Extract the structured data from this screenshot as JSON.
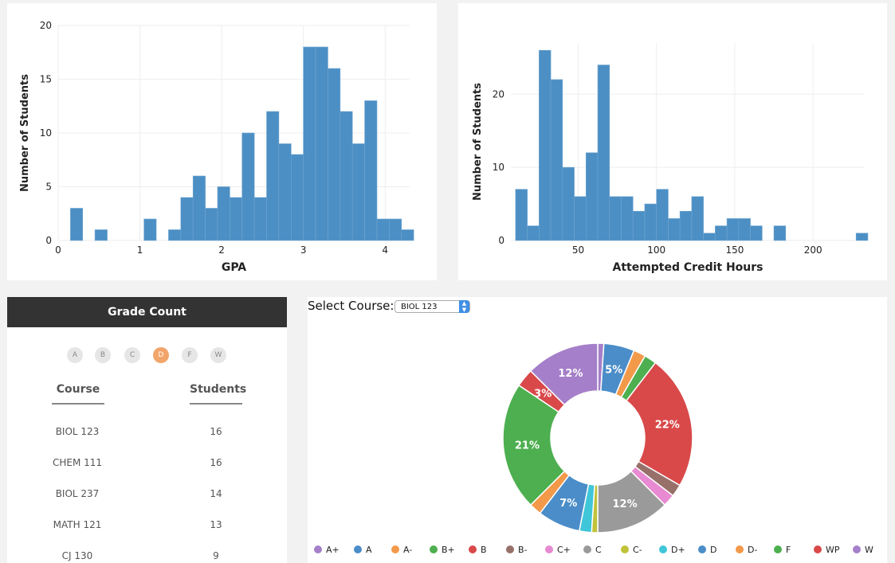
{
  "gpa_chart": {
    "xlabel": "GPA",
    "ylabel": "Number of Students",
    "x_ticks": [
      "0",
      "1",
      "2",
      "3",
      "4"
    ],
    "y_ticks": [
      "0",
      "5",
      "10",
      "15",
      "20"
    ]
  },
  "credit_chart": {
    "xlabel": "Attempted Credit Hours",
    "ylabel": "Number of Students",
    "x_ticks": [
      "50",
      "100",
      "150",
      "200"
    ],
    "y_ticks": [
      "0",
      "10",
      "20"
    ]
  },
  "grade_panel": {
    "title": "Grade Count",
    "grades": [
      "A",
      "B",
      "C",
      "D",
      "F",
      "W"
    ],
    "active_grade": "D",
    "col_course": "Course",
    "col_students": "Students",
    "rows": [
      {
        "course": "BIOL 123",
        "students": "16"
      },
      {
        "course": "CHEM 111",
        "students": "16"
      },
      {
        "course": "BIOL 237",
        "students": "14"
      },
      {
        "course": "MATH 121",
        "students": "13"
      },
      {
        "course": "CJ 130",
        "students": "9"
      }
    ]
  },
  "course_panel": {
    "select_label": "Select Course:",
    "selected_course": "BIOL 123",
    "legend": [
      {
        "label": "A+",
        "color": "#a57fc9"
      },
      {
        "label": "A",
        "color": "#4b8dc8"
      },
      {
        "label": "A-",
        "color": "#f3994a"
      },
      {
        "label": "B+",
        "color": "#4daf4f"
      },
      {
        "label": "B",
        "color": "#d9494a"
      },
      {
        "label": "B-",
        "color": "#98706a"
      },
      {
        "label": "C+",
        "color": "#e88ad1"
      },
      {
        "label": "C",
        "color": "#9a9a9a"
      },
      {
        "label": "C-",
        "color": "#c0c23a"
      },
      {
        "label": "D+",
        "color": "#3fc6d8"
      },
      {
        "label": "D",
        "color": "#4b8dc8"
      },
      {
        "label": "D-",
        "color": "#f3994a"
      },
      {
        "label": "F",
        "color": "#4daf4f"
      },
      {
        "label": "WP",
        "color": "#d9494a"
      },
      {
        "label": "W",
        "color": "#a57fc9"
      }
    ]
  },
  "chart_data": [
    {
      "type": "bar",
      "xlabel": "GPA",
      "ylabel": "Number of Students",
      "xlim": [
        0,
        4.3
      ],
      "ylim": [
        0,
        20
      ],
      "bin_width": 0.15,
      "bins": [
        {
          "x": 0.0,
          "y": 0
        },
        {
          "x": 0.15,
          "y": 3
        },
        {
          "x": 0.3,
          "y": 0
        },
        {
          "x": 0.45,
          "y": 1
        },
        {
          "x": 1.05,
          "y": 2
        },
        {
          "x": 1.35,
          "y": 1
        },
        {
          "x": 1.5,
          "y": 4
        },
        {
          "x": 1.65,
          "y": 6
        },
        {
          "x": 1.8,
          "y": 3
        },
        {
          "x": 1.95,
          "y": 5
        },
        {
          "x": 2.1,
          "y": 4
        },
        {
          "x": 2.25,
          "y": 10
        },
        {
          "x": 2.4,
          "y": 4
        },
        {
          "x": 2.55,
          "y": 12
        },
        {
          "x": 2.7,
          "y": 9
        },
        {
          "x": 2.85,
          "y": 8
        },
        {
          "x": 3.0,
          "y": 18
        },
        {
          "x": 3.15,
          "y": 18
        },
        {
          "x": 3.3,
          "y": 16
        },
        {
          "x": 3.45,
          "y": 12
        },
        {
          "x": 3.6,
          "y": 9
        },
        {
          "x": 3.75,
          "y": 13
        },
        {
          "x": 3.9,
          "y": 2
        },
        {
          "x": 4.05,
          "y": 2
        },
        {
          "x": 4.2,
          "y": 1
        }
      ],
      "color": "#4c8fc4"
    },
    {
      "type": "bar",
      "xlabel": "Attempted Credit Hours",
      "ylabel": "Number of Students",
      "xlim": [
        7,
        233
      ],
      "ylim": [
        0,
        27
      ],
      "bin_width": 7.5,
      "bins": [
        {
          "x": 10,
          "y": 7
        },
        {
          "x": 17.5,
          "y": 2
        },
        {
          "x": 25,
          "y": 26
        },
        {
          "x": 32.5,
          "y": 22
        },
        {
          "x": 40,
          "y": 10
        },
        {
          "x": 47.5,
          "y": 6
        },
        {
          "x": 55,
          "y": 12
        },
        {
          "x": 62.5,
          "y": 24
        },
        {
          "x": 70,
          "y": 6
        },
        {
          "x": 77.5,
          "y": 6
        },
        {
          "x": 85,
          "y": 4
        },
        {
          "x": 92.5,
          "y": 5
        },
        {
          "x": 100,
          "y": 7
        },
        {
          "x": 107.5,
          "y": 3
        },
        {
          "x": 115,
          "y": 4
        },
        {
          "x": 122.5,
          "y": 6
        },
        {
          "x": 130,
          "y": 1
        },
        {
          "x": 137.5,
          "y": 2
        },
        {
          "x": 145,
          "y": 3
        },
        {
          "x": 152.5,
          "y": 3
        },
        {
          "x": 160,
          "y": 2
        },
        {
          "x": 175,
          "y": 2
        },
        {
          "x": 227.5,
          "y": 1
        }
      ],
      "color": "#4c8fc4"
    },
    {
      "type": "pie",
      "title": "BIOL 123",
      "slices": [
        {
          "label": "A+",
          "value": 1,
          "color": "#a57fc9"
        },
        {
          "label": "A",
          "value": 5,
          "color": "#4b8dc8",
          "shown": "5%"
        },
        {
          "label": "A-",
          "value": 2,
          "color": "#f3994a"
        },
        {
          "label": "B+",
          "value": 2,
          "color": "#4daf4f"
        },
        {
          "label": "B",
          "value": 22,
          "color": "#d9494a",
          "shown": "22%"
        },
        {
          "label": "B-",
          "value": 2,
          "color": "#98706a"
        },
        {
          "label": "C+",
          "value": 2,
          "color": "#e88ad1"
        },
        {
          "label": "C",
          "value": 12,
          "color": "#9a9a9a",
          "shown": "12%"
        },
        {
          "label": "C-",
          "value": 1,
          "color": "#c0c23a"
        },
        {
          "label": "D+",
          "value": 2,
          "color": "#3fc6d8"
        },
        {
          "label": "D",
          "value": 7,
          "color": "#4b8dc8",
          "shown": "7%"
        },
        {
          "label": "D-",
          "value": 2,
          "color": "#f3994a"
        },
        {
          "label": "F",
          "value": 21,
          "color": "#4daf4f",
          "shown": "21%"
        },
        {
          "label": "WP",
          "value": 3,
          "color": "#d9494a",
          "shown": "3%"
        },
        {
          "label": "W",
          "value": 12,
          "color": "#a57fc9",
          "shown": "12%"
        }
      ]
    }
  ]
}
